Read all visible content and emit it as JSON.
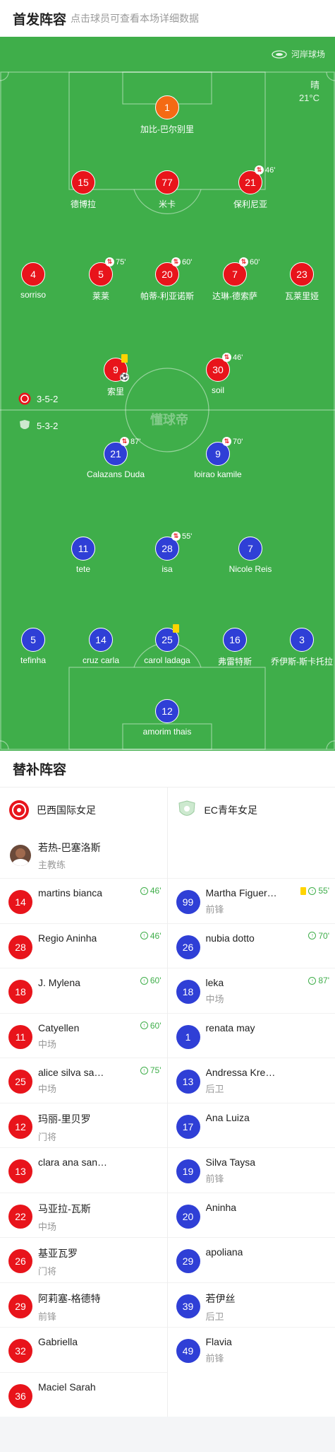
{
  "header": {
    "title": "首发阵容",
    "subtitle": "点击球员可查看本场详细数据"
  },
  "pitch": {
    "venue": "河岸球场",
    "weather": {
      "condition": "晴",
      "temp": "21°C"
    },
    "watermark": "懂球帝",
    "home_formation": "3-5-2",
    "away_formation": "5-3-2",
    "colors": {
      "pitch": "#3fae4a",
      "home": "#e8141b",
      "away": "#2f3fd6",
      "home_gk": "#f46a14"
    },
    "players": [
      {
        "num": "1",
        "name": "加比-巴尔别里",
        "team": "home-gk"
      },
      {
        "num": "15",
        "name": "德博拉",
        "team": "home"
      },
      {
        "num": "77",
        "name": "米卡",
        "team": "home"
      },
      {
        "num": "21",
        "name": "保利尼亚",
        "team": "home",
        "sub": "46'"
      },
      {
        "num": "4",
        "name": "sorriso",
        "team": "home"
      },
      {
        "num": "5",
        "name": "莱莱",
        "team": "home",
        "sub": "75'"
      },
      {
        "num": "20",
        "name": "帕蒂-利亚诺斯",
        "team": "home",
        "sub": "60'"
      },
      {
        "num": "7",
        "name": "达琳-德索萨",
        "team": "home",
        "sub": "60'"
      },
      {
        "num": "23",
        "name": "瓦莱里娅",
        "team": "home"
      },
      {
        "num": "9",
        "name": "索里",
        "team": "home",
        "yellow": true,
        "goal": true
      },
      {
        "num": "30",
        "name": "soil",
        "team": "home",
        "sub": "46'"
      },
      {
        "num": "21",
        "name": "Calazans Duda",
        "team": "away",
        "sub": "87'"
      },
      {
        "num": "9",
        "name": "loirao kamile",
        "team": "away",
        "sub": "70'"
      },
      {
        "num": "11",
        "name": "tete",
        "team": "away"
      },
      {
        "num": "28",
        "name": "isa",
        "team": "away",
        "sub": "55'"
      },
      {
        "num": "7",
        "name": "Nicole Reis",
        "team": "away"
      },
      {
        "num": "5",
        "name": "tefinha",
        "team": "away"
      },
      {
        "num": "14",
        "name": "cruz carla",
        "team": "away"
      },
      {
        "num": "25",
        "name": "carol ladaga",
        "team": "away",
        "yellow": true
      },
      {
        "num": "16",
        "name": "弗雷特斯",
        "team": "away"
      },
      {
        "num": "3",
        "name": "乔伊斯-斯卡托拉",
        "team": "away"
      },
      {
        "num": "12",
        "name": "amorim thais",
        "team": "away"
      }
    ]
  },
  "subs": {
    "title": "替补阵容",
    "home": {
      "team_name": "巴西国际女足",
      "coach": {
        "name": "若热-巴塞洛斯",
        "role": "主教练"
      },
      "players": [
        {
          "num": "14",
          "name": "martins bianca",
          "pos": "",
          "on": "46'"
        },
        {
          "num": "28",
          "name": "Regio Aninha",
          "pos": "",
          "on": "46'"
        },
        {
          "num": "18",
          "name": "J. Mylena",
          "pos": "",
          "on": "60'"
        },
        {
          "num": "11",
          "name": "Catyellen",
          "pos": "中场",
          "on": "60'"
        },
        {
          "num": "25",
          "name": "alice silva sa…",
          "pos": "中场",
          "on": "75'"
        },
        {
          "num": "12",
          "name": "玛丽-里贝罗",
          "pos": "门将"
        },
        {
          "num": "13",
          "name": "clara ana san…",
          "pos": ""
        },
        {
          "num": "22",
          "name": "马亚拉-瓦斯",
          "pos": "中场"
        },
        {
          "num": "26",
          "name": "基亚瓦罗",
          "pos": "门将"
        },
        {
          "num": "29",
          "name": "阿莉塞-格德特",
          "pos": "前锋"
        },
        {
          "num": "32",
          "name": "Gabriella",
          "pos": ""
        },
        {
          "num": "36",
          "name": "Maciel Sarah",
          "pos": ""
        }
      ]
    },
    "away": {
      "team_name": "EC青年女足",
      "players": [
        {
          "num": "99",
          "name": "Martha Figuer…",
          "pos": "前锋",
          "on": "55'",
          "yellow": true
        },
        {
          "num": "26",
          "name": "nubia dotto",
          "pos": "",
          "on": "70'"
        },
        {
          "num": "18",
          "name": "leka",
          "pos": "中场",
          "on": "87'"
        },
        {
          "num": "1",
          "name": "renata may",
          "pos": ""
        },
        {
          "num": "13",
          "name": "Andressa Kre…",
          "pos": "后卫"
        },
        {
          "num": "17",
          "name": "Ana Luiza",
          "pos": ""
        },
        {
          "num": "19",
          "name": "Silva Taysa",
          "pos": "前锋"
        },
        {
          "num": "20",
          "name": "Aninha",
          "pos": ""
        },
        {
          "num": "29",
          "name": "apoliana",
          "pos": ""
        },
        {
          "num": "39",
          "name": "若伊丝",
          "pos": "后卫"
        },
        {
          "num": "49",
          "name": "Flavia",
          "pos": "前锋"
        }
      ]
    }
  }
}
